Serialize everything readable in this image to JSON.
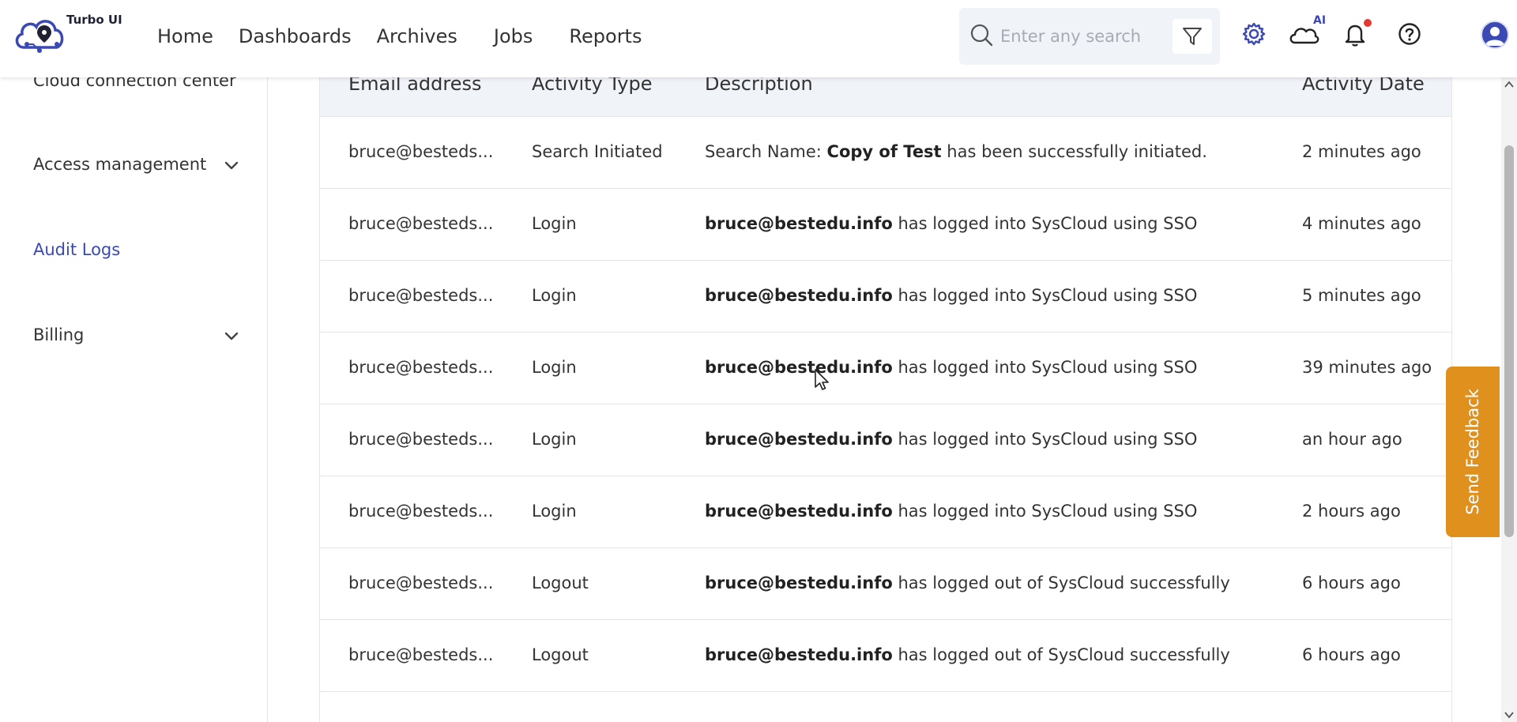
{
  "app": {
    "logo_text": "Turbo UI"
  },
  "nav": {
    "items": [
      "Home",
      "Dashboards",
      "Archives",
      "Jobs",
      "Reports"
    ]
  },
  "search": {
    "placeholder": "Enter any search text"
  },
  "header_icons": {
    "ai_label": "AI",
    "icons": [
      "gear-icon",
      "cloud-ai-icon",
      "bell-icon",
      "help-icon",
      "user-avatar-icon"
    ]
  },
  "sidebar": {
    "items": [
      {
        "label": "Cloud connection center"
      },
      {
        "label": "Access management"
      },
      {
        "label": "Audit Logs"
      },
      {
        "label": "Billing"
      }
    ]
  },
  "table": {
    "headers": [
      "Email address",
      "Activity Type",
      "Description",
      "Activity Date"
    ],
    "rows": [
      {
        "email": "bruce@besteds...",
        "type": "Search Initiated",
        "desc_pre": "Search Name: ",
        "desc_bold": "Copy of Test",
        "desc_post": " has been successfully initiated.",
        "date": "2 minutes ago"
      },
      {
        "email": "bruce@besteds...",
        "type": "Login",
        "desc_pre": "",
        "desc_bold": "bruce@bestedu.info",
        "desc_post": " has logged into SysCloud using SSO",
        "date": "4 minutes ago"
      },
      {
        "email": "bruce@besteds...",
        "type": "Login",
        "desc_pre": "",
        "desc_bold": "bruce@bestedu.info",
        "desc_post": " has logged into SysCloud using SSO",
        "date": "5 minutes ago"
      },
      {
        "email": "bruce@besteds...",
        "type": "Login",
        "desc_pre": "",
        "desc_bold": "bruce@bestedu.info",
        "desc_post": " has logged into SysCloud using SSO",
        "date": "39 minutes ago"
      },
      {
        "email": "bruce@besteds...",
        "type": "Login",
        "desc_pre": "",
        "desc_bold": "bruce@bestedu.info",
        "desc_post": " has logged into SysCloud using SSO",
        "date": "an hour ago"
      },
      {
        "email": "bruce@besteds...",
        "type": "Login",
        "desc_pre": "",
        "desc_bold": "bruce@bestedu.info",
        "desc_post": " has logged into SysCloud using SSO",
        "date": "2 hours ago"
      },
      {
        "email": "bruce@besteds...",
        "type": "Logout",
        "desc_pre": "",
        "desc_bold": "bruce@bestedu.info",
        "desc_post": " has logged out of SysCloud successfully",
        "date": "6 hours ago"
      },
      {
        "email": "bruce@besteds...",
        "type": "Logout",
        "desc_pre": "",
        "desc_bold": "bruce@bestedu.info",
        "desc_post": " has logged out of SysCloud successfully",
        "date": "6 hours ago"
      }
    ]
  },
  "feedback": {
    "label": "Send Feedback"
  },
  "colors": {
    "accent": "#3b49b3",
    "feedback": "#e0901d",
    "header_bg": "#f0f3f8",
    "notification": "#e53935"
  }
}
